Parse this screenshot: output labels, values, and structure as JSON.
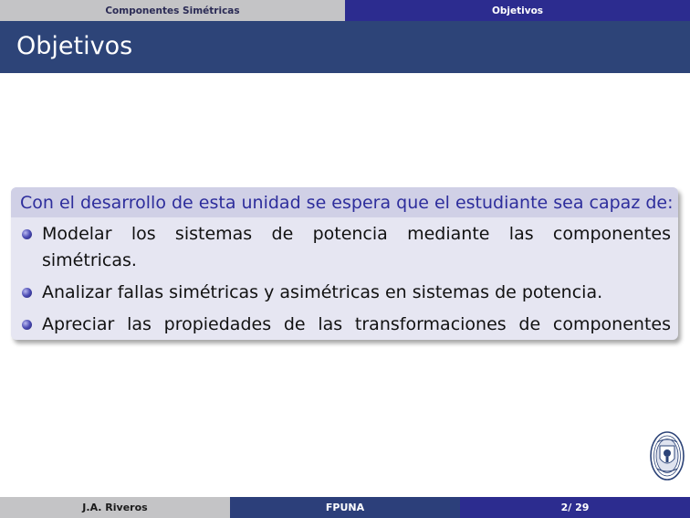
{
  "nav": {
    "sections": [
      {
        "label": "Componentes Simétricas"
      },
      {
        "label": "Objetivos"
      }
    ]
  },
  "frame": {
    "title": "Objetivos"
  },
  "block": {
    "title": "Con el desarrollo de esta unidad se espera que el estudiante sea capaz de:",
    "items": [
      "Modelar los sistemas de potencia mediante las componentes simétricas.",
      "Analizar fallas simétricas y asimétricas en sistemas de potencia.",
      "Apreciar las propiedades de las transformaciones de componentes simétricas para el diseño y operación de sistemas de potencia."
    ]
  },
  "footer": {
    "author": "J.A. Riveros",
    "institution": "FPUNA",
    "page": "2/ 29"
  },
  "colors": {
    "header_bar": "#2d4478",
    "nav_active": "#2c2c8f",
    "block_title_text": "#2d2d9c"
  }
}
